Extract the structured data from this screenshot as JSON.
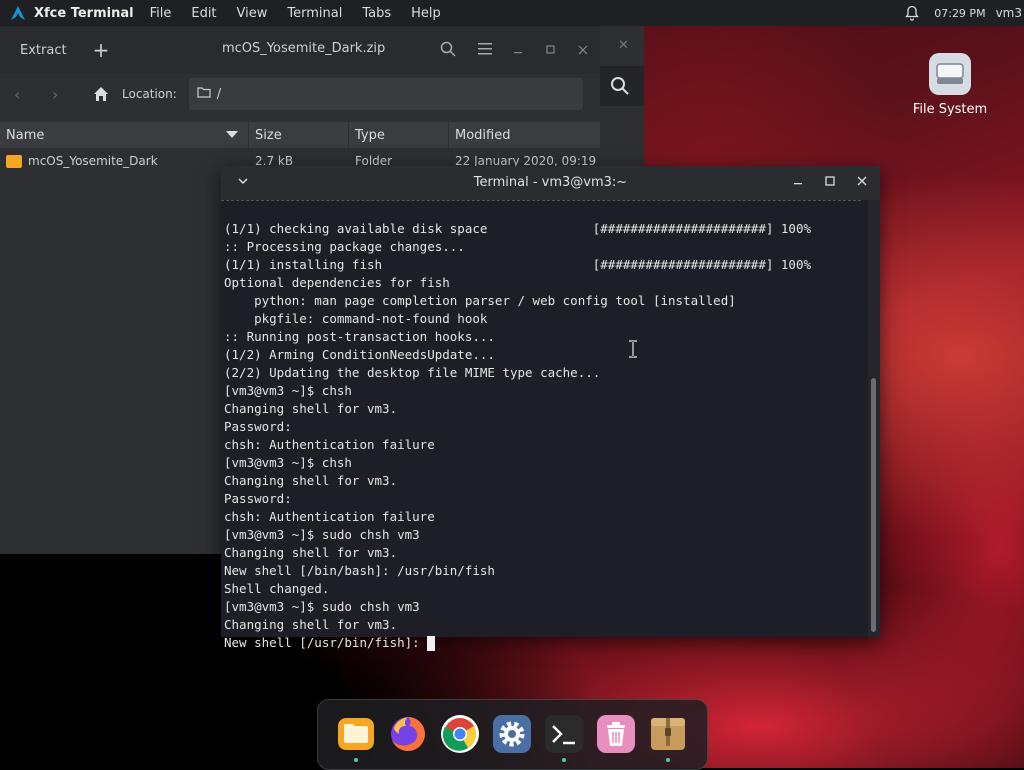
{
  "top_panel": {
    "app_title": "Xfce Terminal",
    "menu": [
      "File",
      "Edit",
      "View",
      "Terminal",
      "Tabs",
      "Help"
    ],
    "clock": "07:29 PM",
    "user": "vm3"
  },
  "archive_window": {
    "extract_label": "Extract",
    "title": "mcOS_Yosemite_Dark.zip",
    "location_label": "Location:",
    "location_value": "/",
    "columns": [
      "Name",
      "Size",
      "Type",
      "Modified"
    ],
    "rows": [
      {
        "name": "mcOS_Yosemite_Dark",
        "size": "2.7 kB",
        "type": "Folder",
        "modified": "22 January 2020, 09:19"
      }
    ]
  },
  "desktop": {
    "icons": [
      {
        "label": "File System",
        "icon": "drive-icon"
      }
    ]
  },
  "terminal": {
    "title": "Terminal - vm3@vm3:~",
    "lines": [
      "(1/1) checking available disk space              [######################] 100%",
      ":: Processing package changes...",
      "(1/1) installing fish                            [######################] 100%",
      "Optional dependencies for fish",
      "    python: man page completion parser / web config tool [installed]",
      "    pkgfile: command-not-found hook",
      ":: Running post-transaction hooks...",
      "(1/2) Arming ConditionNeedsUpdate...",
      "(2/2) Updating the desktop file MIME type cache...",
      "[vm3@vm3 ~]$ chsh",
      "Changing shell for vm3.",
      "Password:",
      "chsh: Authentication failure",
      "[vm3@vm3 ~]$ chsh",
      "Changing shell for vm3.",
      "Password:",
      "chsh: Authentication failure",
      "[vm3@vm3 ~]$ sudo chsh vm3",
      "Changing shell for vm3.",
      "New shell [/bin/bash]: /usr/bin/fish",
      "Shell changed.",
      "[vm3@vm3 ~]$ sudo chsh vm3",
      "Changing shell for vm3."
    ],
    "prompt_line": "New shell [/usr/bin/fish]: "
  },
  "dock": {
    "items": [
      {
        "name": "files",
        "icon": "folder-icon",
        "color": "#f5a623",
        "running": true
      },
      {
        "name": "firefox",
        "icon": "firefox-icon",
        "color": "#ff7139",
        "running": false
      },
      {
        "name": "chrome",
        "icon": "chrome-icon",
        "color": "#ffffff",
        "running": false
      },
      {
        "name": "settings",
        "icon": "gear-icon",
        "color": "#4a6fa5",
        "running": false
      },
      {
        "name": "terminal",
        "icon": "terminal-icon",
        "color": "#2b2b2b",
        "running": true
      },
      {
        "name": "trash",
        "icon": "trash-icon",
        "color": "#e88fc0",
        "running": false
      },
      {
        "name": "archive-manager",
        "icon": "archive-icon",
        "color": "#c89a5b",
        "running": true
      }
    ]
  }
}
